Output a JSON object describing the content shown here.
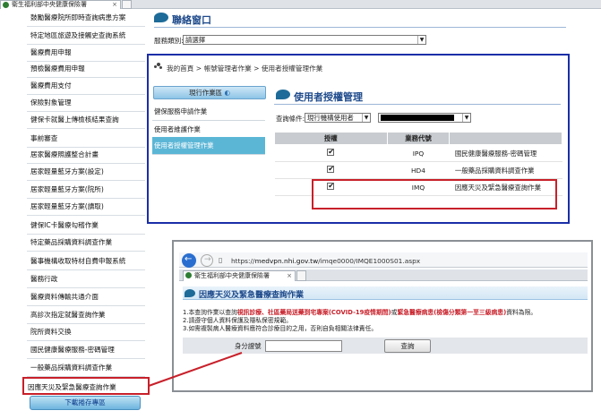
{
  "browser": {
    "tab_title": "衛生福利部中央健康保險署"
  },
  "sidebar": {
    "items": [
      {
        "label": "鼓勵醫療院所即時查詢病患方案"
      },
      {
        "label": "特定地區旅遊及接觸史查詢系統"
      },
      {
        "label": "醫療費用申報"
      },
      {
        "label": "預檢醫療費用申報"
      },
      {
        "label": "醫療費用支付"
      },
      {
        "label": "保險對象管理"
      },
      {
        "label": "健保卡就醫上傳檢核結果查詢"
      },
      {
        "label": "事前審查"
      },
      {
        "label": "居家醫療照護整合計畫"
      },
      {
        "label": "居家輕量藍牙方案(設定)"
      },
      {
        "label": "居家輕量藍牙方案(院所)"
      },
      {
        "label": "居家輕量藍牙方案(讀取)"
      },
      {
        "label": "健保IC卡醫療勾稽作業"
      },
      {
        "label": "特定藥品採購資料調查作業"
      },
      {
        "label": "醫事機構收取特材自費申報系統"
      },
      {
        "label": "醫務行政"
      },
      {
        "label": "醫療資料傳輸共通介面"
      },
      {
        "label": "高診次指定就醫查詢作業"
      },
      {
        "label": "院所資料交換"
      },
      {
        "label": "國民健康醫療服務-密碼管理"
      },
      {
        "label": "一般藥品採購資料調查作業"
      },
      {
        "label": "因應天災及緊急醫療查詢作業"
      }
    ],
    "download_button": "下載捲存專區"
  },
  "contact": {
    "title": "聯絡窗口",
    "service_label": "服務類別:",
    "service_select": "請選擇"
  },
  "main": {
    "breadcrumb": "我的首頁 > 帳號管理者作業 > 使用者授權管理作業",
    "current_task_button": "現行作業區",
    "menu": [
      {
        "label": "健保服務申請作業"
      },
      {
        "label": "使用者維護作業"
      },
      {
        "label": "使用者授權管理作業"
      }
    ],
    "section_title": "使用者授權管理",
    "query_label": "查詢條件:",
    "query_select": "現行機構使用者",
    "table": {
      "headers": [
        "授權",
        "業務代號",
        ""
      ],
      "rows": [
        {
          "checked": true,
          "code": "IPQ",
          "name": "國民健康醫療服務-密碼管理"
        },
        {
          "checked": true,
          "code": "HD4",
          "name": "一般藥品採購資料調查作業"
        },
        {
          "checked": true,
          "code": "IMQ",
          "name": "因應天災及緊急醫療查詢作業"
        }
      ]
    }
  },
  "popup": {
    "url_prefix": "https://",
    "url_host": "medvpn.nhi.gov.tw",
    "url_path": "/imqe0000/IMQE1000S01.aspx",
    "tab_title": "衛生福利部中央健康保險署",
    "title": "因應天災及緊急醫療查詢作業",
    "notice1_pre": "1.本查詢作業以查詢",
    "notice1_red1": "視訊診療、社區藥局送藥到宅專案(COVID-19疫情期間)",
    "notice1_mid": "或",
    "notice1_red2": "緊急醫療病患(檢傷分類第一至三級病患)",
    "notice1_post": "資料為限。",
    "notice2": "2.請遵守個人資料保護及隱私保密規範。",
    "notice3": "3.如需複製病人醫療資料應符合診療目的之用，否則自負相關法律責任。",
    "id_label": "身分證號",
    "id_value": "",
    "query_button": "查詢"
  },
  "colors": {
    "highlight_red": "#c8202a",
    "frame_blue": "#1a2ea8",
    "active_menu": "#5bb6d6",
    "heading_blue": "#1e4a8b"
  }
}
